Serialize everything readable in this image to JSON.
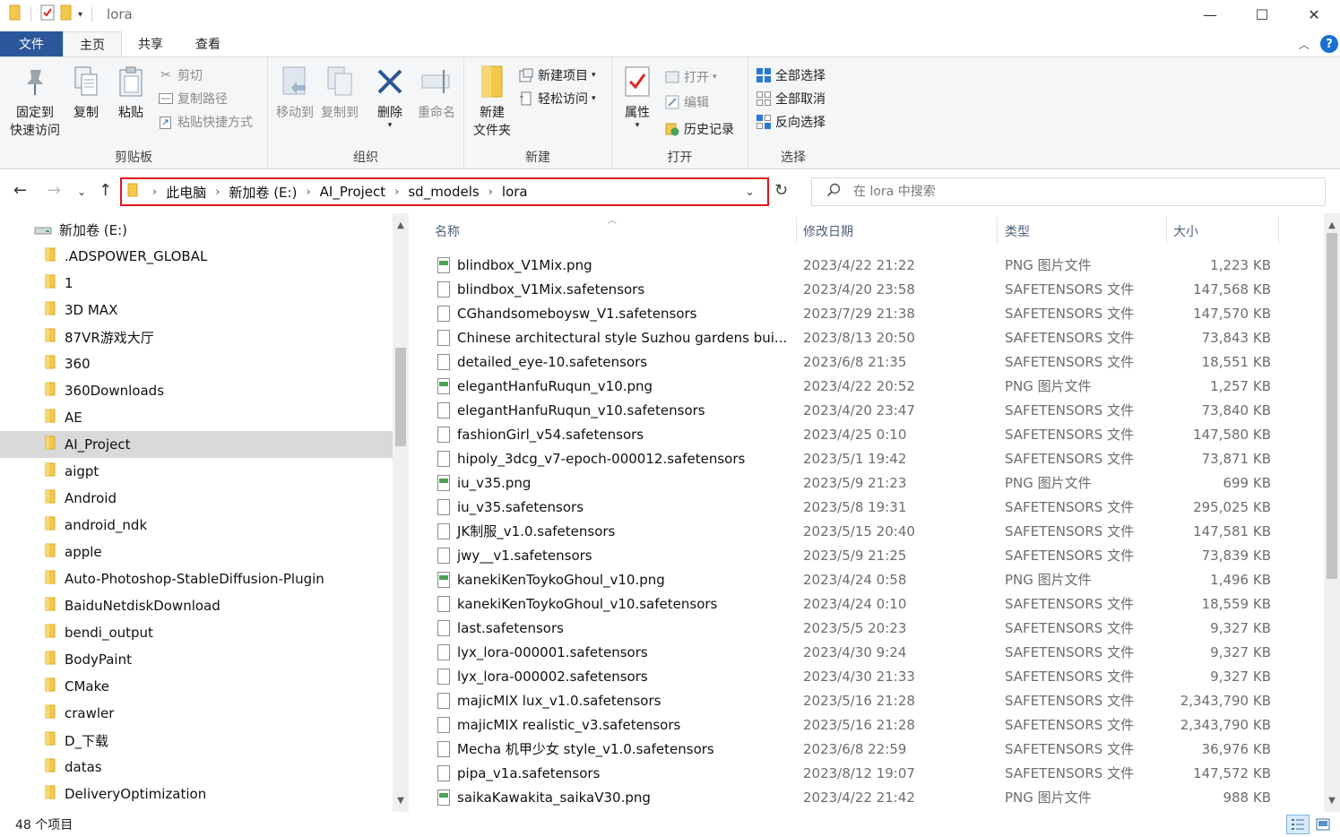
{
  "window": {
    "title": "lora",
    "controls": {
      "minimize": "—",
      "maximize": "☐",
      "close": "✕"
    }
  },
  "tabs": {
    "file": "文件",
    "items": [
      "主页",
      "共享",
      "查看"
    ],
    "active": "主页",
    "collapse": "︿",
    "help": "?"
  },
  "ribbon": {
    "clipboard": {
      "label": "剪贴板",
      "pin_line1": "固定到",
      "pin_line2": "快速访问",
      "copy": "复制",
      "paste": "粘贴",
      "cut": "剪切",
      "copy_path": "复制路径",
      "paste_shortcut": "粘贴快捷方式"
    },
    "organize": {
      "label": "组织",
      "move_to": "移动到",
      "copy_to": "复制到",
      "delete": "删除",
      "rename": "重命名"
    },
    "new": {
      "label": "新建",
      "new_item": "新建项目",
      "easy_access": "轻松访问",
      "new_folder_line1": "新建",
      "new_folder_line2": "文件夹"
    },
    "open": {
      "label": "打开",
      "properties": "属性",
      "open": "打开",
      "edit": "编辑",
      "history": "历史记录"
    },
    "select": {
      "label": "选择",
      "select_all": "全部选择",
      "select_none": "全部取消",
      "invert": "反向选择"
    }
  },
  "address": {
    "crumbs": [
      "此电脑",
      "新加卷 (E:)",
      "AI_Project",
      "sd_models",
      "lora"
    ],
    "search_placeholder": "在 lora 中搜索"
  },
  "nav": {
    "root": "新加卷 (E:)",
    "selected": "AI_Project",
    "items": [
      ".ADSPOWER_GLOBAL",
      "1",
      "3D MAX",
      "87VR游戏大厅",
      "360",
      "360Downloads",
      "AE",
      "AI_Project",
      "aigpt",
      "Android",
      "android_ndk",
      "apple",
      "Auto-Photoshop-StableDiffusion-Plugin",
      "BaiduNetdiskDownload",
      "bendi_output",
      "BodyPaint",
      "CMake",
      "crawler",
      "D_下载",
      "datas",
      "DeliveryOptimization"
    ]
  },
  "columns": {
    "name": "名称",
    "date": "修改日期",
    "type": "类型",
    "size": "大小"
  },
  "files": [
    {
      "name": "blindbox_V1Mix.png",
      "date": "2023/4/22 21:22",
      "type": "PNG 图片文件",
      "size": "1,223 KB",
      "kind": "png"
    },
    {
      "name": "blindbox_V1Mix.safetensors",
      "date": "2023/4/20 23:58",
      "type": "SAFETENSORS 文件",
      "size": "147,568 KB",
      "kind": "file"
    },
    {
      "name": "CGhandsomeboysw_V1.safetensors",
      "date": "2023/7/29 21:38",
      "type": "SAFETENSORS 文件",
      "size": "147,570 KB",
      "kind": "file"
    },
    {
      "name": "Chinese architectural style Suzhou gardens     bui...",
      "date": "2023/8/13 20:50",
      "type": "SAFETENSORS 文件",
      "size": "73,843 KB",
      "kind": "file"
    },
    {
      "name": "detailed_eye-10.safetensors",
      "date": "2023/6/8 21:35",
      "type": "SAFETENSORS 文件",
      "size": "18,551 KB",
      "kind": "file"
    },
    {
      "name": "elegantHanfuRuqun_v10.png",
      "date": "2023/4/22 20:52",
      "type": "PNG 图片文件",
      "size": "1,257 KB",
      "kind": "png"
    },
    {
      "name": "elegantHanfuRuqun_v10.safetensors",
      "date": "2023/4/20 23:47",
      "type": "SAFETENSORS 文件",
      "size": "73,840 KB",
      "kind": "file"
    },
    {
      "name": "fashionGirl_v54.safetensors",
      "date": "2023/4/25 0:10",
      "type": "SAFETENSORS 文件",
      "size": "147,580 KB",
      "kind": "file"
    },
    {
      "name": "hipoly_3dcg_v7-epoch-000012.safetensors",
      "date": "2023/5/1 19:42",
      "type": "SAFETENSORS 文件",
      "size": "73,871 KB",
      "kind": "file"
    },
    {
      "name": "iu_v35.png",
      "date": "2023/5/9 21:23",
      "type": "PNG 图片文件",
      "size": "699 KB",
      "kind": "png"
    },
    {
      "name": "iu_v35.safetensors",
      "date": "2023/5/8 19:31",
      "type": "SAFETENSORS 文件",
      "size": "295,025 KB",
      "kind": "file"
    },
    {
      "name": "JK制服_v1.0.safetensors",
      "date": "2023/5/15 20:40",
      "type": "SAFETENSORS 文件",
      "size": "147,581 KB",
      "kind": "file"
    },
    {
      "name": "jwy__v1.safetensors",
      "date": "2023/5/9 21:25",
      "type": "SAFETENSORS 文件",
      "size": "73,839 KB",
      "kind": "file"
    },
    {
      "name": "kanekiKenToykoGhoul_v10.png",
      "date": "2023/4/24 0:58",
      "type": "PNG 图片文件",
      "size": "1,496 KB",
      "kind": "png"
    },
    {
      "name": "kanekiKenToykoGhoul_v10.safetensors",
      "date": "2023/4/24 0:10",
      "type": "SAFETENSORS 文件",
      "size": "18,559 KB",
      "kind": "file"
    },
    {
      "name": "last.safetensors",
      "date": "2023/5/5 20:23",
      "type": "SAFETENSORS 文件",
      "size": "9,327 KB",
      "kind": "file"
    },
    {
      "name": "lyx_lora-000001.safetensors",
      "date": "2023/4/30 9:24",
      "type": "SAFETENSORS 文件",
      "size": "9,327 KB",
      "kind": "file"
    },
    {
      "name": "lyx_lora-000002.safetensors",
      "date": "2023/4/30 21:33",
      "type": "SAFETENSORS 文件",
      "size": "9,327 KB",
      "kind": "file"
    },
    {
      "name": "majicMIX lux_v1.0.safetensors",
      "date": "2023/5/16 21:28",
      "type": "SAFETENSORS 文件",
      "size": "2,343,790 KB",
      "kind": "file"
    },
    {
      "name": "majicMIX realistic_v3.safetensors",
      "date": "2023/5/16 21:28",
      "type": "SAFETENSORS 文件",
      "size": "2,343,790 KB",
      "kind": "file"
    },
    {
      "name": "Mecha 机甲少女 style_v1.0.safetensors",
      "date": "2023/6/8 22:59",
      "type": "SAFETENSORS 文件",
      "size": "36,976 KB",
      "kind": "file"
    },
    {
      "name": "pipa_v1a.safetensors",
      "date": "2023/8/12 19:07",
      "type": "SAFETENSORS 文件",
      "size": "147,572 KB",
      "kind": "file"
    },
    {
      "name": "saikaKawakita_saikaV30.png",
      "date": "2023/4/22 21:42",
      "type": "PNG 图片文件",
      "size": "988 KB",
      "kind": "png"
    }
  ],
  "status": {
    "count": "48 个项目"
  },
  "colors": {
    "accent": "#2b579a",
    "highlight_border": "#e0141e",
    "folder": "#f2c94c"
  }
}
